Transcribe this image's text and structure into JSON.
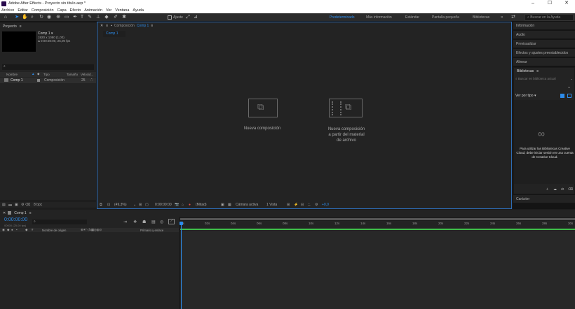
{
  "window": {
    "title": "Adobe After Effects - Proyecto sin título.aep *",
    "minimize": "–",
    "maximize": "☐",
    "close": "✕"
  },
  "menu": [
    "Archivo",
    "Editar",
    "Composición",
    "Capa",
    "Efecto",
    "Animación",
    "Ver",
    "Ventana",
    "Ayuda"
  ],
  "toolbar": {
    "align_label": "Ajuste",
    "workspaces": [
      "Predeterminado",
      "Más información",
      "Estándar",
      "Pantalla pequeña",
      "Bibliotecas"
    ],
    "search_placeholder": "Buscar en la Ayuda",
    "menu_glyph": "»"
  },
  "project": {
    "panel_title": "Proyecto",
    "comp_name": "Comp 1 ▾",
    "comp_info1": "1920 x 1080 (1,00)",
    "comp_info2": "Δ 0:00:30:00, 25,00 fps",
    "search_glyph": "⌕",
    "columns": [
      "Nombre",
      "Tipo",
      "Tamaño",
      "Velocid..."
    ],
    "items": [
      {
        "name": "Comp 1",
        "type": "Composición",
        "fps": "25"
      }
    ],
    "bpc": "8 bpc"
  },
  "composition": {
    "panel_title": "Composición",
    "comp_link": "Comp 1",
    "tab": "Comp 1",
    "new_comp": "Nueva composición",
    "new_from_footage": [
      "Nueva composición",
      "a partir del material",
      "de archivo"
    ],
    "footer": {
      "zoom": "(49,3%)",
      "time": "0:00:00:00",
      "resolution": "(Mitad)",
      "camera": "Cámara activa",
      "views": "1 Vista",
      "exposure": "+0,0"
    }
  },
  "right_panels": [
    "Información",
    "Audio",
    "Previsualizar",
    "Efectos y ajustes preestablecidos",
    "Alinear"
  ],
  "libraries": {
    "title": "Bibliotecas",
    "search_placeholder": "Buscar en biblioteca actual",
    "view_by": "Ver por tipo ▾",
    "message": [
      "Para utilizar las Bibliotecas Creative",
      "Cloud, debe iniciar sesión en una cuenta",
      "de Creative Cloud."
    ]
  },
  "character_label": "Carácter",
  "timeline": {
    "tab": "Comp 1",
    "time": "0:00:00:00",
    "frame_info": "00000 (25,00 fps)",
    "col_source": "Nombre de origen",
    "col_parent": "Primario y enlace",
    "ticks": [
      "0s",
      "02s",
      "04s",
      "06s",
      "08s",
      "10s",
      "12s",
      "14s",
      "16s",
      "18s",
      "20s",
      "22s",
      "24s",
      "26s",
      "28s",
      "30s"
    ]
  },
  "colors": {
    "accent": "#2d8ceb",
    "play_green": "#3fbf4a",
    "titlebar": "#ffffff",
    "panel": "#232323"
  }
}
